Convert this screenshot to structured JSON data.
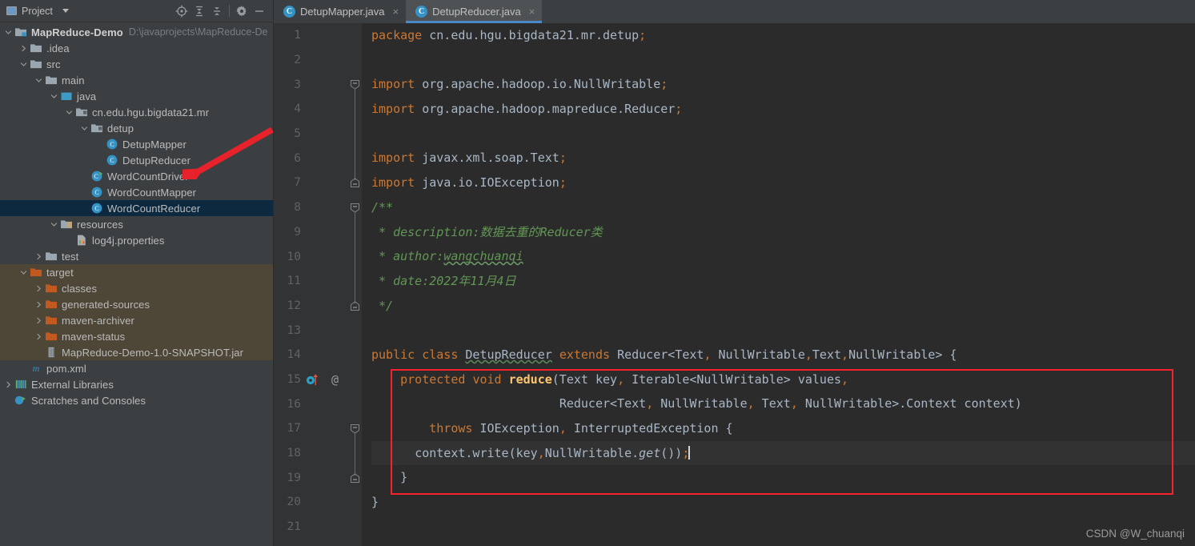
{
  "window": {
    "sidebar_title": "Project",
    "toolbar_icons": [
      "locate-icon",
      "expand-all-icon",
      "collapse-all-icon",
      "settings-gear-icon",
      "minimize-icon"
    ]
  },
  "project_tree": [
    {
      "label": "MapReduce-Demo",
      "sub": "D:\\javaprojects\\MapReduce-De",
      "depth": 0,
      "arrow": "down",
      "icon": "project-module-icon",
      "bold": true,
      "state": "normal"
    },
    {
      "label": ".idea",
      "sub": "",
      "depth": 1,
      "arrow": "right",
      "icon": "folder-icon",
      "bold": false,
      "state": "normal"
    },
    {
      "label": "src",
      "sub": "",
      "depth": 1,
      "arrow": "down",
      "icon": "folder-icon",
      "bold": false,
      "state": "normal"
    },
    {
      "label": "main",
      "sub": "",
      "depth": 2,
      "arrow": "down",
      "icon": "folder-icon",
      "bold": false,
      "state": "normal"
    },
    {
      "label": "java",
      "sub": "",
      "depth": 3,
      "arrow": "down",
      "icon": "source-root-icon",
      "bold": false,
      "state": "normal"
    },
    {
      "label": "cn.edu.hgu.bigdata21.mr",
      "sub": "",
      "depth": 4,
      "arrow": "down",
      "icon": "package-icon",
      "bold": false,
      "state": "normal"
    },
    {
      "label": "detup",
      "sub": "",
      "depth": 5,
      "arrow": "down",
      "icon": "package-icon",
      "bold": false,
      "state": "normal"
    },
    {
      "label": "DetupMapper",
      "sub": "",
      "depth": 6,
      "arrow": "none",
      "icon": "java-class-icon",
      "bold": false,
      "state": "normal"
    },
    {
      "label": "DetupReducer",
      "sub": "",
      "depth": 6,
      "arrow": "none",
      "icon": "java-class-icon",
      "bold": false,
      "state": "normal"
    },
    {
      "label": "WordCountDriver",
      "sub": "",
      "depth": 5,
      "arrow": "none",
      "icon": "java-runnable-class-icon",
      "bold": false,
      "state": "normal"
    },
    {
      "label": "WordCountMapper",
      "sub": "",
      "depth": 5,
      "arrow": "none",
      "icon": "java-class-icon",
      "bold": false,
      "state": "normal"
    },
    {
      "label": "WordCountReducer",
      "sub": "",
      "depth": 5,
      "arrow": "none",
      "icon": "java-class-icon",
      "bold": false,
      "state": "selected"
    },
    {
      "label": "resources",
      "sub": "",
      "depth": 3,
      "arrow": "down",
      "icon": "resource-root-icon",
      "bold": false,
      "state": "normal"
    },
    {
      "label": "log4j.properties",
      "sub": "",
      "depth": 4,
      "arrow": "none",
      "icon": "properties-file-icon",
      "bold": false,
      "state": "normal"
    },
    {
      "label": "test",
      "sub": "",
      "depth": 2,
      "arrow": "right",
      "icon": "folder-icon",
      "bold": false,
      "state": "normal"
    },
    {
      "label": "target",
      "sub": "",
      "depth": 1,
      "arrow": "down",
      "icon": "excluded-folder-icon",
      "bold": false,
      "state": "excluded"
    },
    {
      "label": "classes",
      "sub": "",
      "depth": 2,
      "arrow": "right",
      "icon": "excluded-folder-icon",
      "bold": false,
      "state": "excluded"
    },
    {
      "label": "generated-sources",
      "sub": "",
      "depth": 2,
      "arrow": "right",
      "icon": "excluded-folder-icon",
      "bold": false,
      "state": "excluded"
    },
    {
      "label": "maven-archiver",
      "sub": "",
      "depth": 2,
      "arrow": "right",
      "icon": "excluded-folder-icon",
      "bold": false,
      "state": "excluded"
    },
    {
      "label": "maven-status",
      "sub": "",
      "depth": 2,
      "arrow": "right",
      "icon": "excluded-folder-icon",
      "bold": false,
      "state": "excluded"
    },
    {
      "label": "MapReduce-Demo-1.0-SNAPSHOT.jar",
      "sub": "",
      "depth": 2,
      "arrow": "none",
      "icon": "jar-file-icon",
      "bold": false,
      "state": "excluded"
    },
    {
      "label": "pom.xml",
      "sub": "",
      "depth": 1,
      "arrow": "none",
      "icon": "maven-pom-icon",
      "bold": false,
      "state": "normal"
    },
    {
      "label": "External Libraries",
      "sub": "",
      "depth": 0,
      "arrow": "right",
      "icon": "libraries-icon",
      "bold": false,
      "state": "normal"
    },
    {
      "label": "Scratches and Consoles",
      "sub": "",
      "depth": 0,
      "arrow": "none",
      "icon": "scratches-icon",
      "bold": false,
      "state": "normal"
    }
  ],
  "tabs": [
    {
      "label": "DetupMapper.java",
      "active": false,
      "icon": "java-class-icon",
      "close": "×"
    },
    {
      "label": "DetupReducer.java",
      "active": true,
      "icon": "java-class-icon",
      "close": "×"
    }
  ],
  "editor": {
    "line_numbers": [
      "1",
      "2",
      "3",
      "4",
      "5",
      "6",
      "7",
      "8",
      "9",
      "10",
      "11",
      "12",
      "13",
      "14",
      "15",
      "16",
      "17",
      "18",
      "19",
      "20",
      "21"
    ],
    "gutter_annotation_line": "15",
    "gutter_annotation_symbol": "@",
    "gutter_override_marker": "override-method-icon",
    "code_lines": [
      "package cn.edu.hgu.bigdata21.mr.detup;",
      "",
      "import org.apache.hadoop.io.NullWritable;",
      "import org.apache.hadoop.mapreduce.Reducer;",
      "",
      "import javax.xml.soap.Text;",
      "import java.io.IOException;",
      "/**",
      " * description:数据去重的Reducer类",
      " * author:wangchuanqi",
      " * date:2022年11月4日",
      " */",
      "",
      "public class DetupReducer extends Reducer<Text, NullWritable,Text,NullWritable> {",
      "    protected void reduce(Text key, Iterable<NullWritable> values,",
      "                          Reducer<Text, NullWritable, Text, NullWritable>.Context context)",
      "        throws IOException, InterruptedException {",
      "      context.write(key,NullWritable.get());",
      "    }",
      "}",
      ""
    ]
  },
  "annotations": {
    "watermark": "CSDN @W_chuanqi",
    "arrow_color": "#e8222a",
    "redbox_color": "#f5222d"
  }
}
